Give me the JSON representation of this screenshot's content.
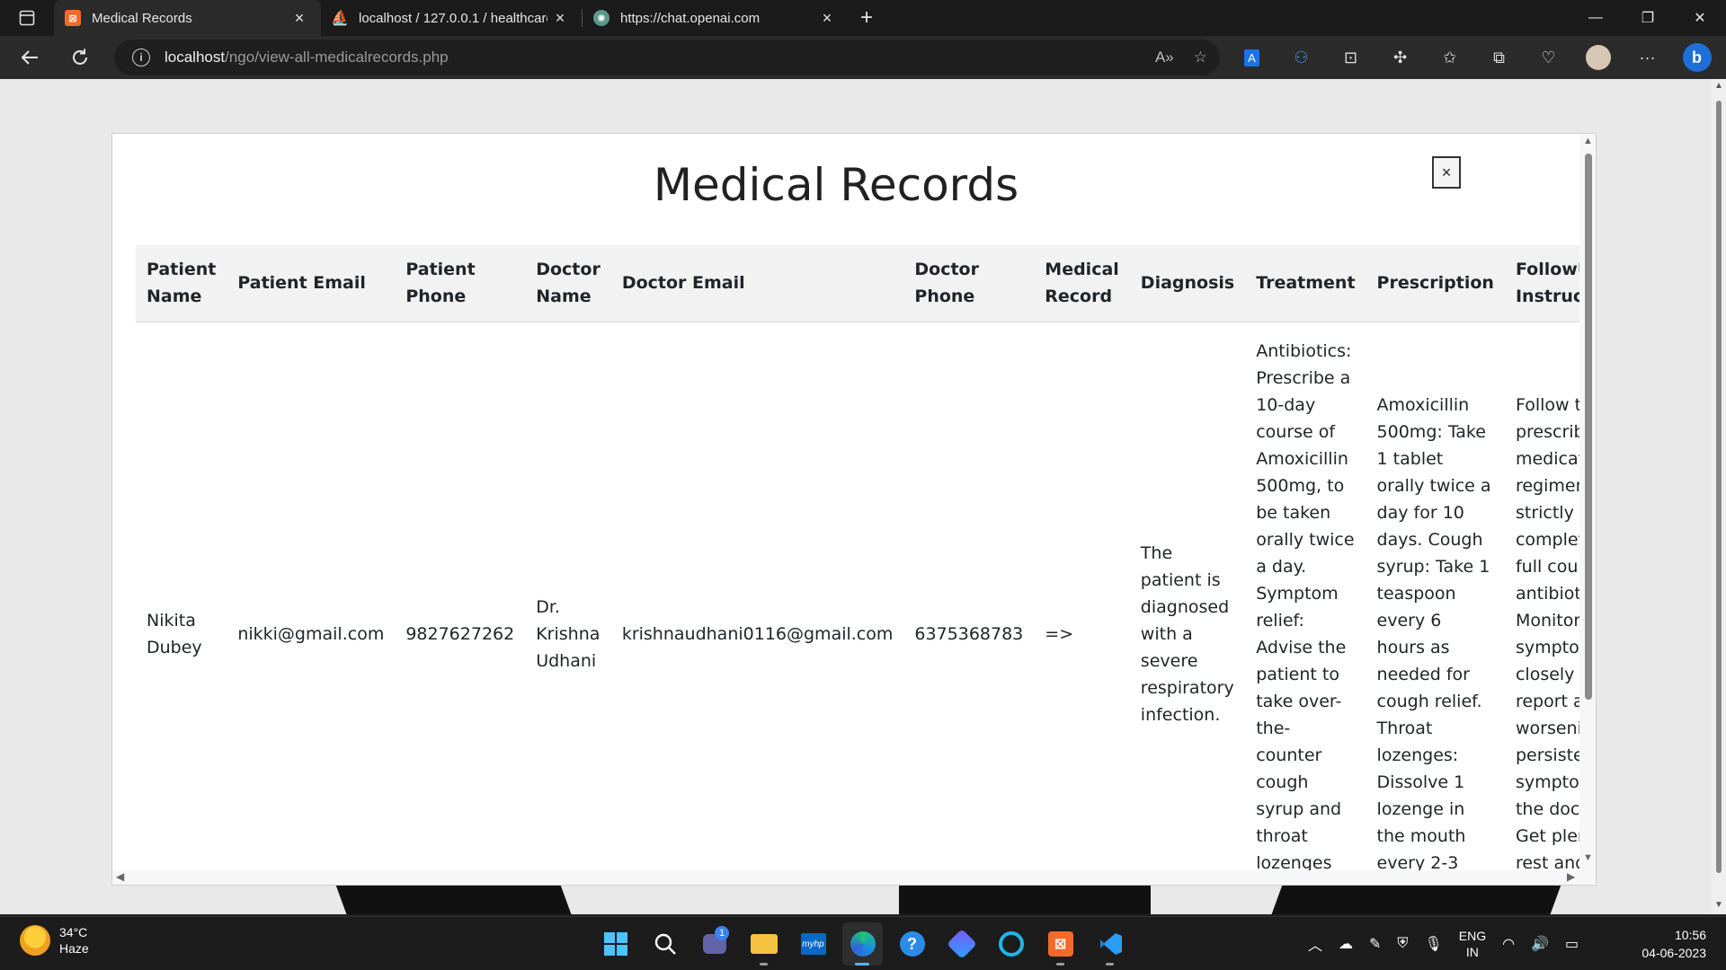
{
  "browser": {
    "tabs": [
      {
        "label": "Medical Records",
        "icon": "xampp-icon",
        "active": true
      },
      {
        "label": "localhost / 127.0.0.1 / healthcare",
        "icon": "phpmyadmin-icon",
        "active": false
      },
      {
        "label": "https://chat.openai.com",
        "icon": "openai-icon",
        "active": false
      }
    ],
    "url_host": "localhost",
    "url_path": "/ngo/view-all-medicalrecords.php"
  },
  "modal": {
    "title": "Medical Records",
    "close_label": "×"
  },
  "table": {
    "headers": {
      "patient_name": "Patient Name",
      "patient_email": "Patient Email",
      "patient_phone": "Patient Phone",
      "doctor_name": "Doctor Name",
      "doctor_email": "Doctor Email",
      "doctor_phone": "Doctor Phone",
      "medical_record": "Medical Record",
      "diagnosis": "Diagnosis",
      "treatment": "Treatment",
      "prescription": "Prescription",
      "followup": "FollowUp Instructions"
    },
    "rows": [
      {
        "patient_name": "Nikita Dubey",
        "patient_email": "nikki@gmail.com",
        "patient_phone": "9827627262",
        "doctor_name": "Dr. Krishna Udhani",
        "doctor_email": "krishnaudhani0116@gmail.com",
        "doctor_phone": "6375368783",
        "medical_record": "=>",
        "diagnosis": "The patient is diagnosed with a severe respiratory infection.",
        "treatment": "Antibiotics: Prescribe a 10-day course of Amoxicillin 500mg, to be taken orally twice a day. Symptom relief: Advise the patient to take over-the-counter cough syrup and throat lozenges as needed. Rest and",
        "prescription": "Amoxicillin 500mg: Take 1 tablet orally twice a day for 10 days. Cough syrup: Take 1 teaspoon every 6 hours as needed for cough relief. Throat lozenges: Dissolve 1 lozenge in the mouth every 2-3",
        "followup": "Follow the prescribed medication regimen strictly and complete the full course of antibiotics. Monitor symptoms closely and report any worsening or persistent symptoms to the doctor. Get plenty of rest and"
      }
    ]
  },
  "taskbar": {
    "weather_temp": "34°C",
    "weather_desc": "Haze",
    "lang_top": "ENG",
    "lang_bottom": "IN",
    "time": "10:56",
    "date": "04-06-2023",
    "chat_badge": "1"
  }
}
